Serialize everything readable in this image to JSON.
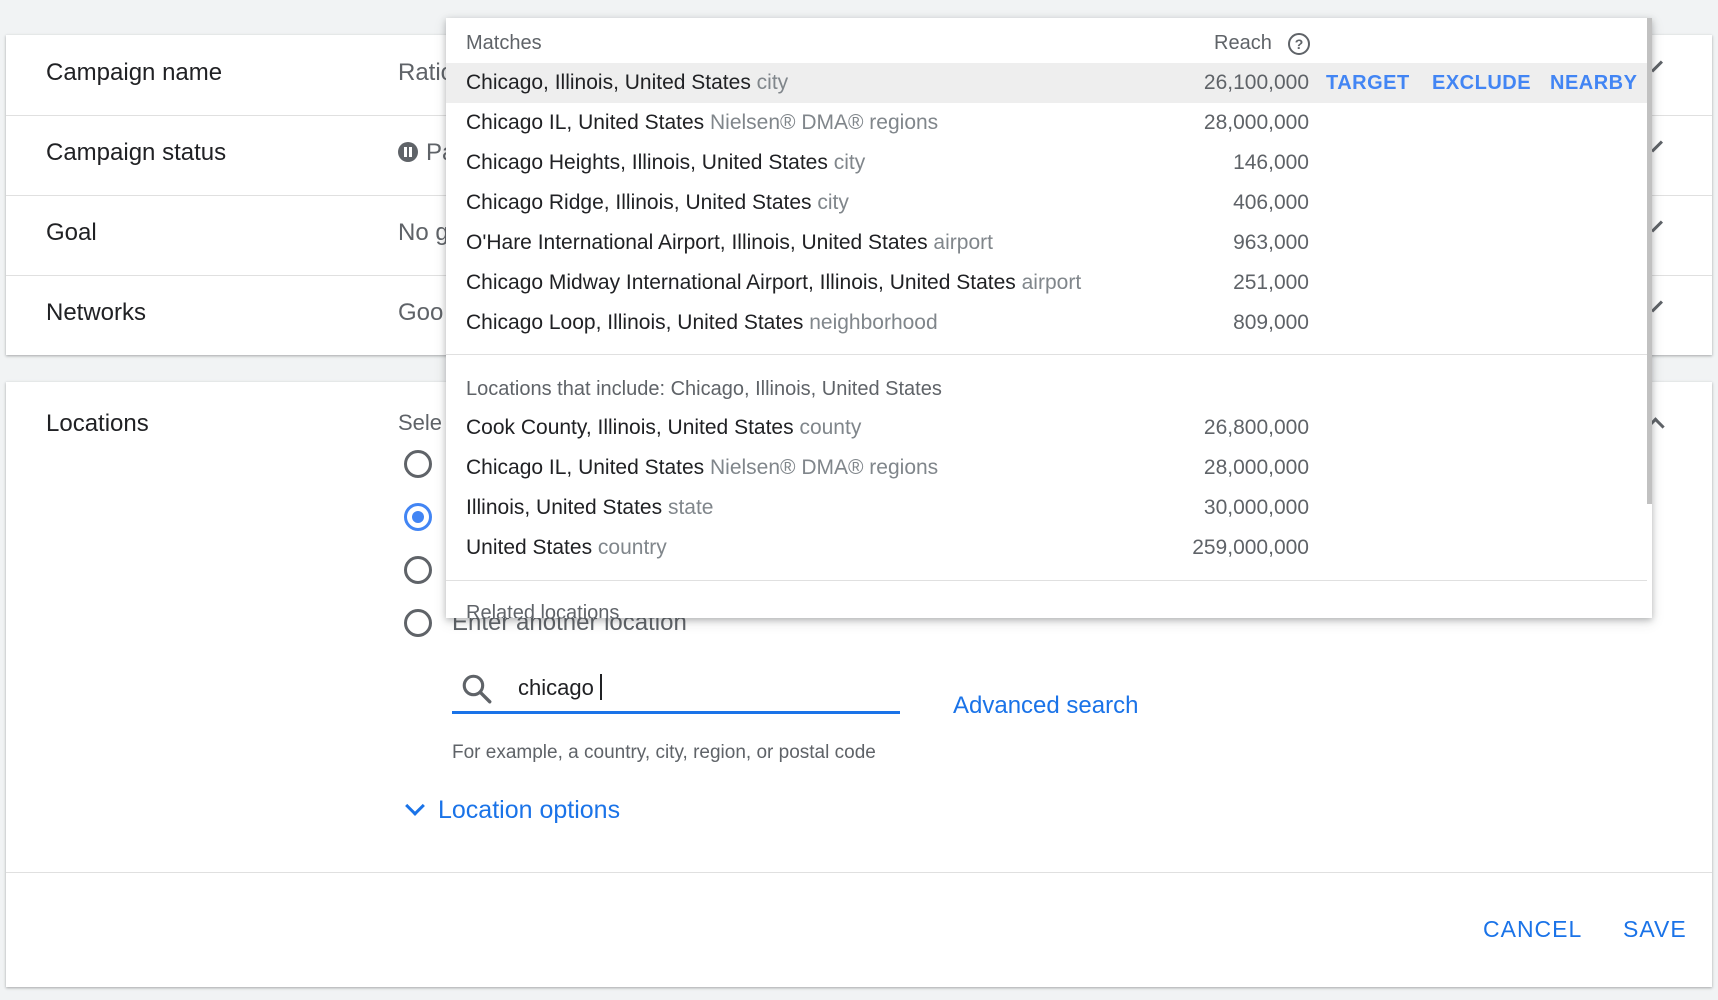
{
  "summary": {
    "rows": [
      {
        "label": "Campaign name",
        "value": "Ratio"
      },
      {
        "label": "Campaign status",
        "value": "Pa"
      },
      {
        "label": "Goal",
        "value": "No g"
      },
      {
        "label": "Networks",
        "value": "Goo"
      }
    ]
  },
  "locations": {
    "title": "Locations",
    "select_label": "Sele",
    "radios": [
      {
        "label": "",
        "checked": false
      },
      {
        "label": "",
        "checked": true
      },
      {
        "label": "",
        "checked": false
      },
      {
        "label": "Enter another location",
        "checked": false
      }
    ],
    "search": {
      "value": "chicago",
      "icon": "search-icon"
    },
    "helper": "For example, a country, city, region, or postal code",
    "advanced_search": "Advanced search",
    "location_options": "Location options",
    "cancel": "CANCEL",
    "save": "SAVE"
  },
  "dropdown": {
    "matches_header": "Matches",
    "reach_header": "Reach",
    "actions": {
      "target": "TARGET",
      "exclude": "EXCLUDE",
      "nearby": "NEARBY"
    },
    "matches": [
      {
        "name": "Chicago, Illinois, United States",
        "type": "city",
        "reach": "26,100,000"
      },
      {
        "name": "Chicago IL, United States",
        "type": "Nielsen® DMA® regions",
        "reach": "28,000,000"
      },
      {
        "name": "Chicago Heights, Illinois, United States",
        "type": "city",
        "reach": "146,000"
      },
      {
        "name": "Chicago Ridge, Illinois, United States",
        "type": "city",
        "reach": "406,000"
      },
      {
        "name": "O'Hare International Airport, Illinois, United States",
        "type": "airport",
        "reach": "963,000"
      },
      {
        "name": "Chicago Midway International Airport, Illinois, United States",
        "type": "airport",
        "reach": "251,000"
      },
      {
        "name": "Chicago Loop, Illinois, United States",
        "type": "neighborhood",
        "reach": "809,000"
      }
    ],
    "includes_header": "Locations that include: Chicago, Illinois, United States",
    "includes": [
      {
        "name": "Cook County, Illinois, United States",
        "type": "county",
        "reach": "26,800,000"
      },
      {
        "name": "Chicago IL, United States",
        "type": "Nielsen® DMA® regions",
        "reach": "28,000,000"
      },
      {
        "name": "Illinois, United States",
        "type": "state",
        "reach": "30,000,000"
      },
      {
        "name": "United States",
        "type": "country",
        "reach": "259,000,000"
      }
    ],
    "related_header": "Related locations"
  }
}
